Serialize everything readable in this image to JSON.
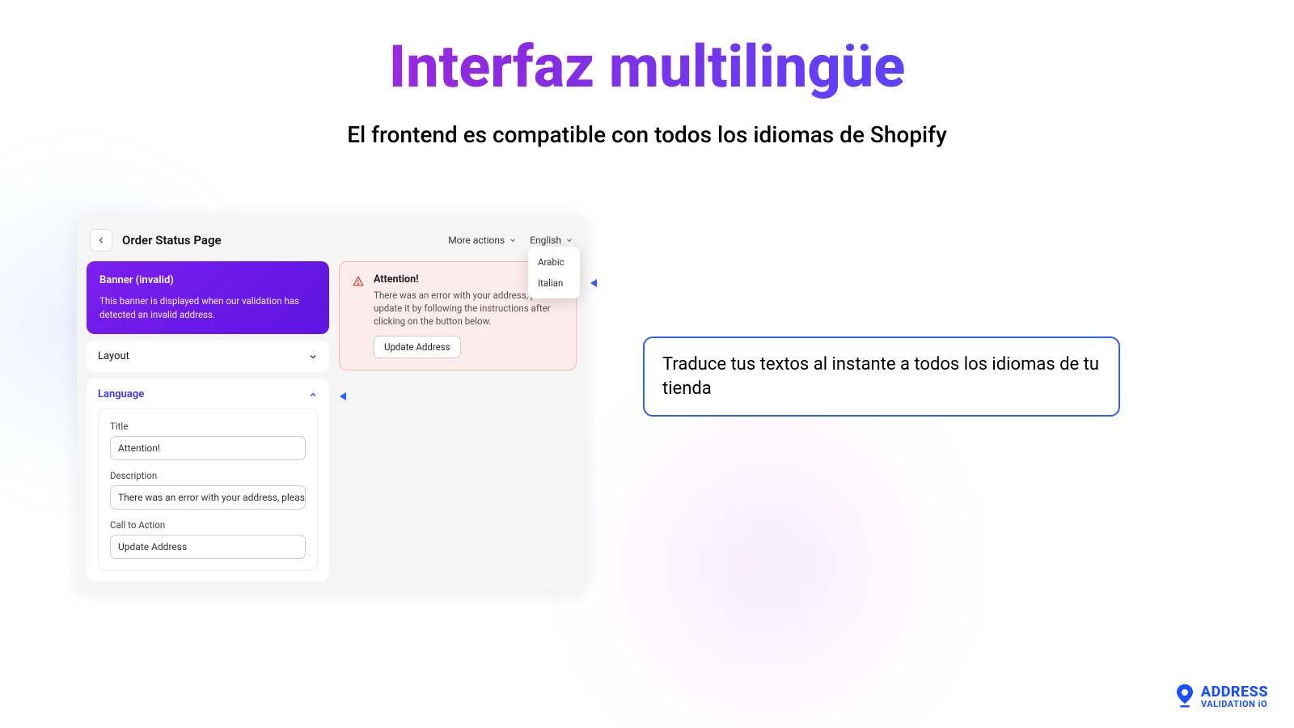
{
  "title": "Interfaz multilingüe",
  "subtitle": "El frontend es compatible con todos los idiomas de Shopify",
  "panel": {
    "page_title": "Order Status Page",
    "more_actions": "More actions",
    "language_current": "English",
    "lang_options": [
      "Arabic",
      "Italian"
    ]
  },
  "banner": {
    "title": "Banner (invalid)",
    "desc": "This banner is displayed when our validation has detected an invalid address."
  },
  "accordion": {
    "layout": "Layout",
    "language": "Language"
  },
  "fields": {
    "title_label": "Title",
    "title_value": "Attention!",
    "desc_label": "Description",
    "desc_value": "There was an error with your address, please update it b",
    "cta_label": "Call to Action",
    "cta_value": "Update Address"
  },
  "alert": {
    "title": "Attention!",
    "desc": "There was an error with your address, please update it by following the instructions after clicking on the button below.",
    "button": "Update Address"
  },
  "callout": "Traduce tus textos al instante a todos los idiomas de tu tienda",
  "logo": {
    "top": "ADDRESS",
    "bottom": "VALIDATION iO"
  }
}
